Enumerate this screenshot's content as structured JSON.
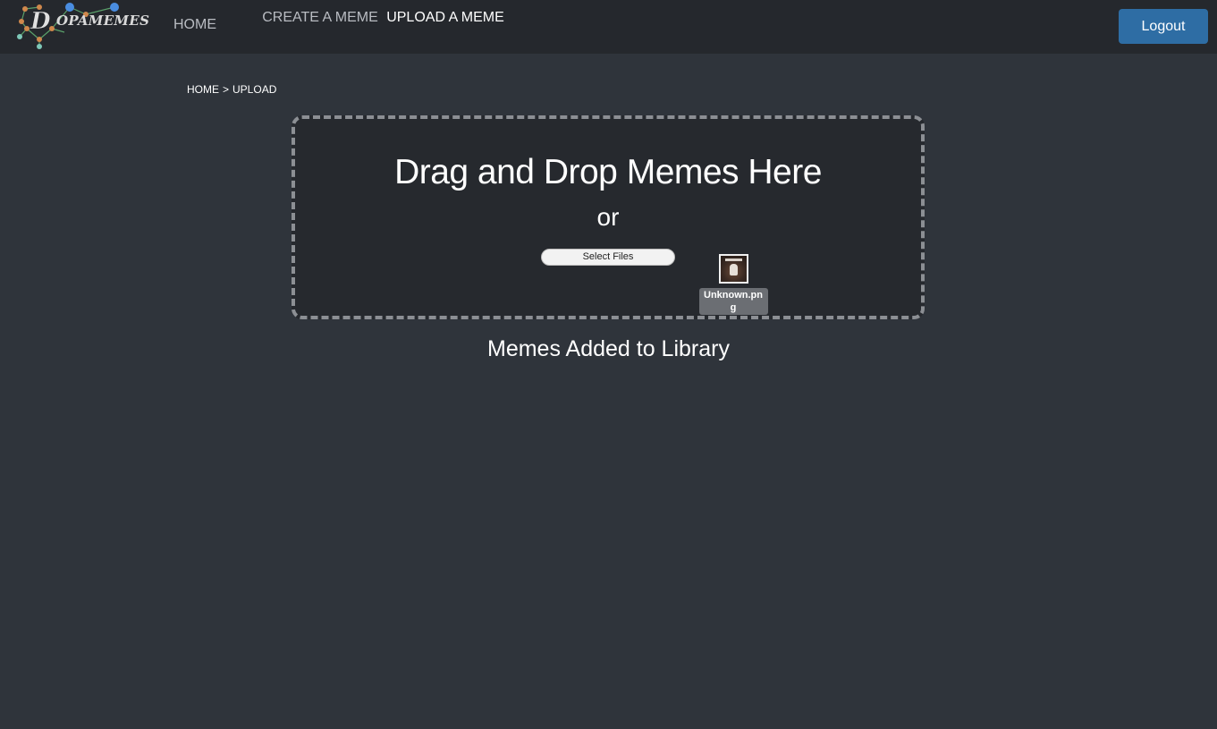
{
  "brand": {
    "logo_text": "OPAMEMES",
    "logo_initial": "D"
  },
  "nav": {
    "home": "HOME",
    "create": "CREATE A MEME",
    "upload": "UPLOAD A MEME"
  },
  "header": {
    "logout_label": "Logout"
  },
  "breadcrumb": {
    "home": "HOME",
    "separator": ">",
    "current": "UPLOAD"
  },
  "dropzone": {
    "title": "Drag and Drop Memes Here",
    "or": "or",
    "select_button": "Select Files",
    "dragged_file": {
      "name": "Unknown.png",
      "icon": "image-thumbnail-icon"
    }
  },
  "library": {
    "heading": "Memes Added to Library"
  },
  "colors": {
    "page_bg": "#2f343b",
    "navbar_bg": "#25282d",
    "dropzone_bg": "#26292e",
    "logout_bg": "#2e6da4",
    "nav_inactive": "#b9bcc2",
    "nav_active": "#ffffff"
  }
}
